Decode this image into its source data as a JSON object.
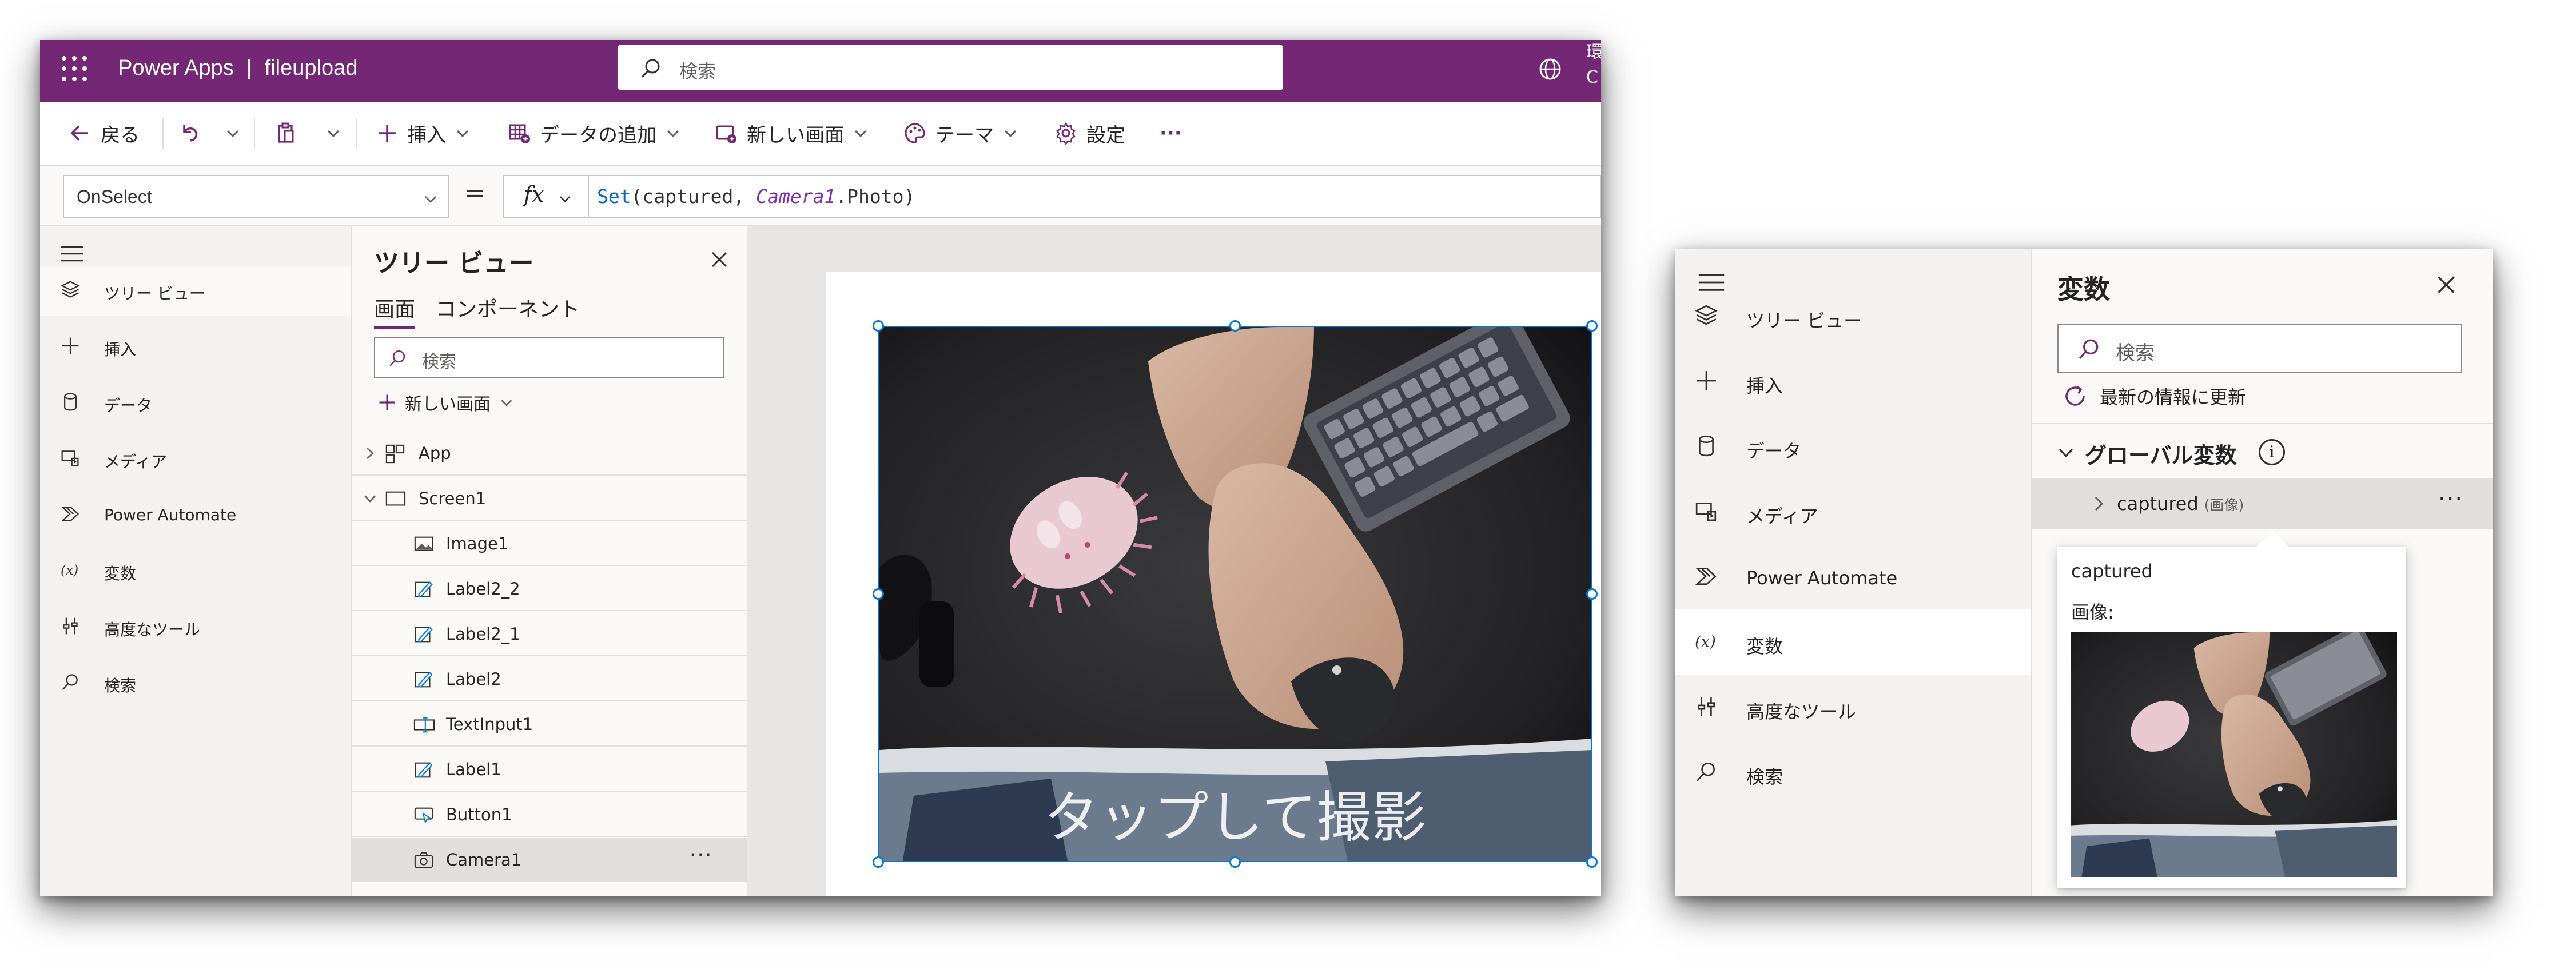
{
  "main_window": {
    "app_name": "Power Apps",
    "separator": "|",
    "app_file": "fileupload",
    "search_placeholder": "検索",
    "env_line1": "環",
    "env_line2": "C",
    "toolbar": {
      "back": "戻る",
      "insert": "挿入",
      "add_data": "データの追加",
      "new_screen": "新しい画面",
      "theme": "テーマ",
      "settings": "設定",
      "more": "···"
    },
    "formula_bar": {
      "property": "OnSelect",
      "equals": "=",
      "fx": "fx",
      "fn": "Set",
      "args_1": "(captured, ",
      "control": "Camera1",
      "args_2": ".Photo)"
    },
    "nav": [
      {
        "label": "ツリー ビュー",
        "icon": "layers-icon"
      },
      {
        "label": "挿入",
        "icon": "plus-icon"
      },
      {
        "label": "データ",
        "icon": "database-icon"
      },
      {
        "label": "メディア",
        "icon": "media-icon"
      },
      {
        "label": "Power Automate",
        "icon": "power-automate-icon"
      },
      {
        "label": "変数",
        "icon": "variable-icon"
      },
      {
        "label": "高度なツール",
        "icon": "tools-icon"
      },
      {
        "label": "検索",
        "icon": "search-icon"
      }
    ],
    "tree": {
      "title": "ツリー ビュー",
      "tab_screens": "画面",
      "tab_components": "コンポーネント",
      "search_placeholder": "検索",
      "new_screen": "新しい画面",
      "rows": [
        {
          "label": "App",
          "icon": "app-icon"
        },
        {
          "label": "Screen1",
          "icon": "screen-icon"
        },
        {
          "label": "Image1",
          "icon": "image-icon"
        },
        {
          "label": "Label2_2",
          "icon": "label-icon"
        },
        {
          "label": "Label2_1",
          "icon": "label-icon"
        },
        {
          "label": "Label2",
          "icon": "label-icon"
        },
        {
          "label": "TextInput1",
          "icon": "textinput-icon"
        },
        {
          "label": "Label1",
          "icon": "label-icon"
        },
        {
          "label": "Button1",
          "icon": "button-icon"
        },
        {
          "label": "Camera1",
          "icon": "camera-icon"
        }
      ],
      "row_more": "···"
    },
    "canvas": {
      "camera_overlay_text": "タップして撮影"
    }
  },
  "variables_window": {
    "nav": [
      {
        "label": "ツリー ビュー",
        "icon": "layers-icon"
      },
      {
        "label": "挿入",
        "icon": "plus-icon"
      },
      {
        "label": "データ",
        "icon": "database-icon"
      },
      {
        "label": "メディア",
        "icon": "media-icon"
      },
      {
        "label": "Power Automate",
        "icon": "power-automate-icon"
      },
      {
        "label": "変数",
        "icon": "variable-icon"
      },
      {
        "label": "高度なツール",
        "icon": "tools-icon"
      },
      {
        "label": "検索",
        "icon": "search-icon"
      }
    ],
    "title": "変数",
    "search_placeholder": "検索",
    "refresh": "最新の情報に更新",
    "global_header": "グローバル変数",
    "info_glyph": "i",
    "variable_name": "captured",
    "variable_type": "(画像)",
    "more": "···",
    "tooltip_name": "captured",
    "tooltip_label": "画像:"
  },
  "colors": {
    "brand": "#742774",
    "selection": "#0078d4"
  }
}
